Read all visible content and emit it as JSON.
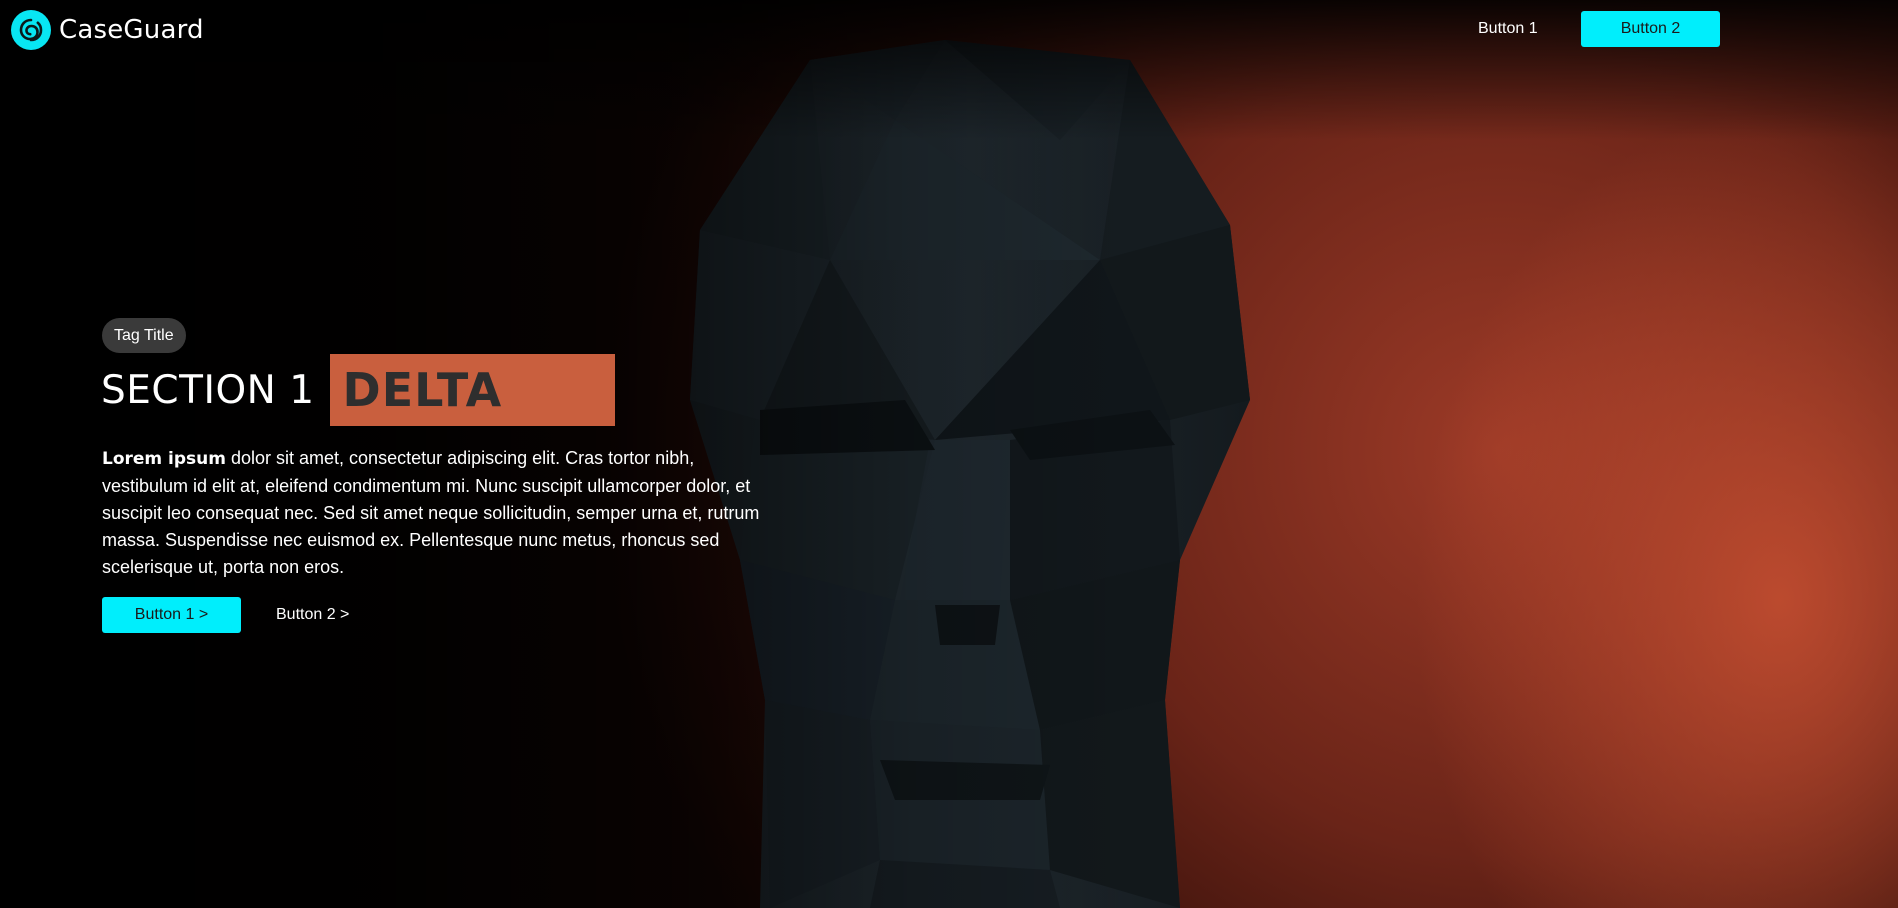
{
  "header": {
    "brand_name": "CaseGuard",
    "logo_icon": "spiral-swirl-icon",
    "nav_button_1": "Button 1",
    "nav_button_2": "Button 2"
  },
  "hero": {
    "tag": "Tag Title",
    "title": "SECTION 1",
    "title_highlight": "DELTA",
    "body_bold": "Lorem ipsum",
    "body_text": " dolor sit amet, consectetur adipiscing elit. Cras tortor nibh, vestibulum id elit at, eleifend condimentum mi. Nunc suscipit ullamcorper dolor, et suscipit leo consequat nec. Sed sit amet neque sollicitudin, semper urna et, rutrum massa. Suspendisse nec euismod ex. Pellentesque nunc metus, rhoncus sed scelerisque ut, porta non eros.",
    "cta_primary": "Button 1 >",
    "cta_secondary": "Button 2 >"
  },
  "theme": {
    "accent": "#00eefc",
    "highlight": "#c95f3e",
    "background": "#000000",
    "tag_background": "#3a3a3a"
  }
}
